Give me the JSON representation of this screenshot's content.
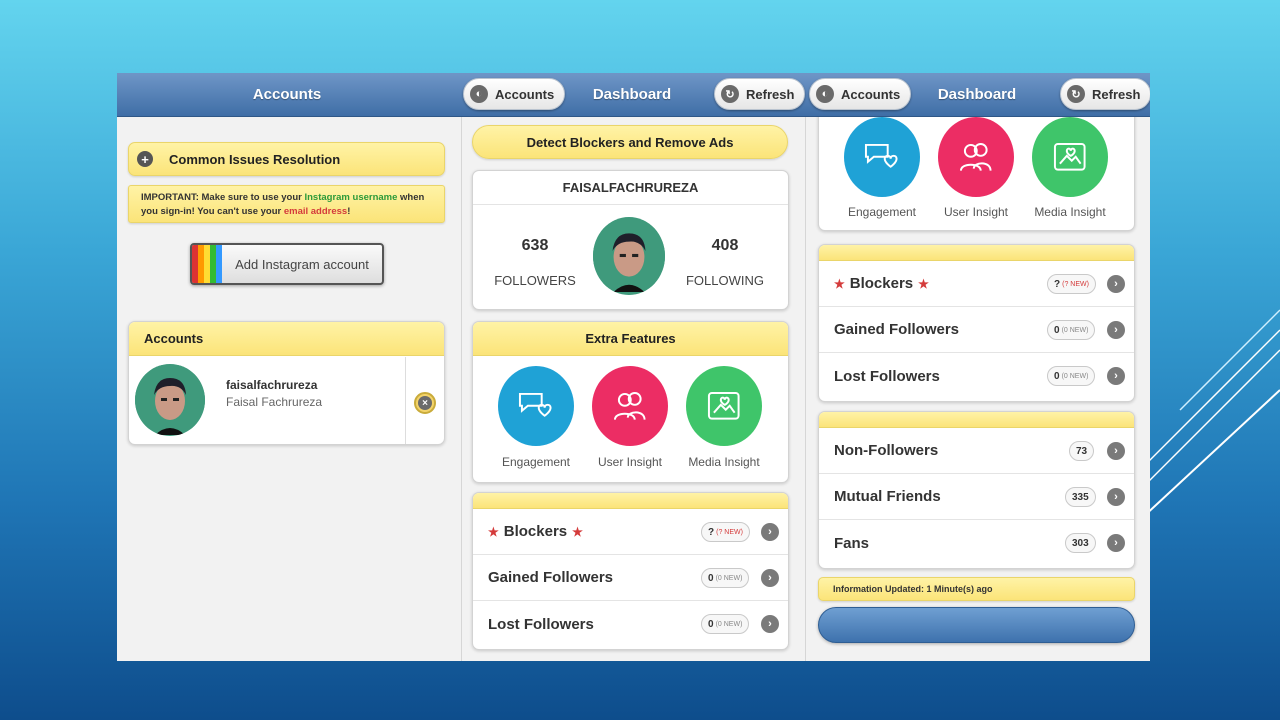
{
  "colors": {
    "accent_yellow": "#fbe479",
    "bar_blue": "#4a78b0",
    "engagement": "#1fa2d6",
    "user_insight": "#ec2d64",
    "media_insight": "#3fc56a"
  },
  "panel1": {
    "title": "Accounts",
    "common_issues": "Common Issues Resolution",
    "important_prefix": "IMPORTANT: Make sure to use your ",
    "important_green": "Instagram username",
    "important_mid": " when you sign-in! You can't use your ",
    "important_red": "email address",
    "important_end": "!",
    "add_account": "Add Instagram account",
    "accounts_header": "Accounts",
    "account": {
      "username": "faisalfachrureza",
      "name": "Faisal Fachrureza"
    }
  },
  "panel2": {
    "accounts_btn": "Accounts",
    "title": "Dashboard",
    "refresh_btn": "Refresh",
    "detect_btn": "Detect Blockers and Remove Ads",
    "profile_name": "FAISALFACHRUREZA",
    "followers_count": "638",
    "followers_label": "FOLLOWERS",
    "following_count": "408",
    "following_label": "FOLLOWING",
    "extra_header": "Extra Features",
    "features": [
      "Engagement",
      "User Insight",
      "Media Insight"
    ],
    "rows": [
      {
        "label": "Blockers",
        "count": "?",
        "new": "(? NEW)"
      },
      {
        "label": "Gained Followers",
        "count": "0",
        "new": "(0 NEW)"
      },
      {
        "label": "Lost Followers",
        "count": "0",
        "new": "(0 NEW)"
      }
    ]
  },
  "panel3": {
    "accounts_btn": "Accounts",
    "title": "Dashboard",
    "refresh_btn": "Refresh",
    "features": [
      "Engagement",
      "User Insight",
      "Media Insight"
    ],
    "rows": [
      {
        "label": "Blockers",
        "count": "?",
        "new": "(? NEW)"
      },
      {
        "label": "Gained Followers",
        "count": "0",
        "new": "(0 NEW)"
      },
      {
        "label": "Lost Followers",
        "count": "0",
        "new": "(0 NEW)"
      }
    ],
    "rows2": [
      {
        "label": "Non-Followers",
        "count": "73"
      },
      {
        "label": "Mutual Friends",
        "count": "335"
      },
      {
        "label": "Fans",
        "count": "303"
      }
    ],
    "info_updated": "Information Updated: 1 Minute(s) ago"
  }
}
